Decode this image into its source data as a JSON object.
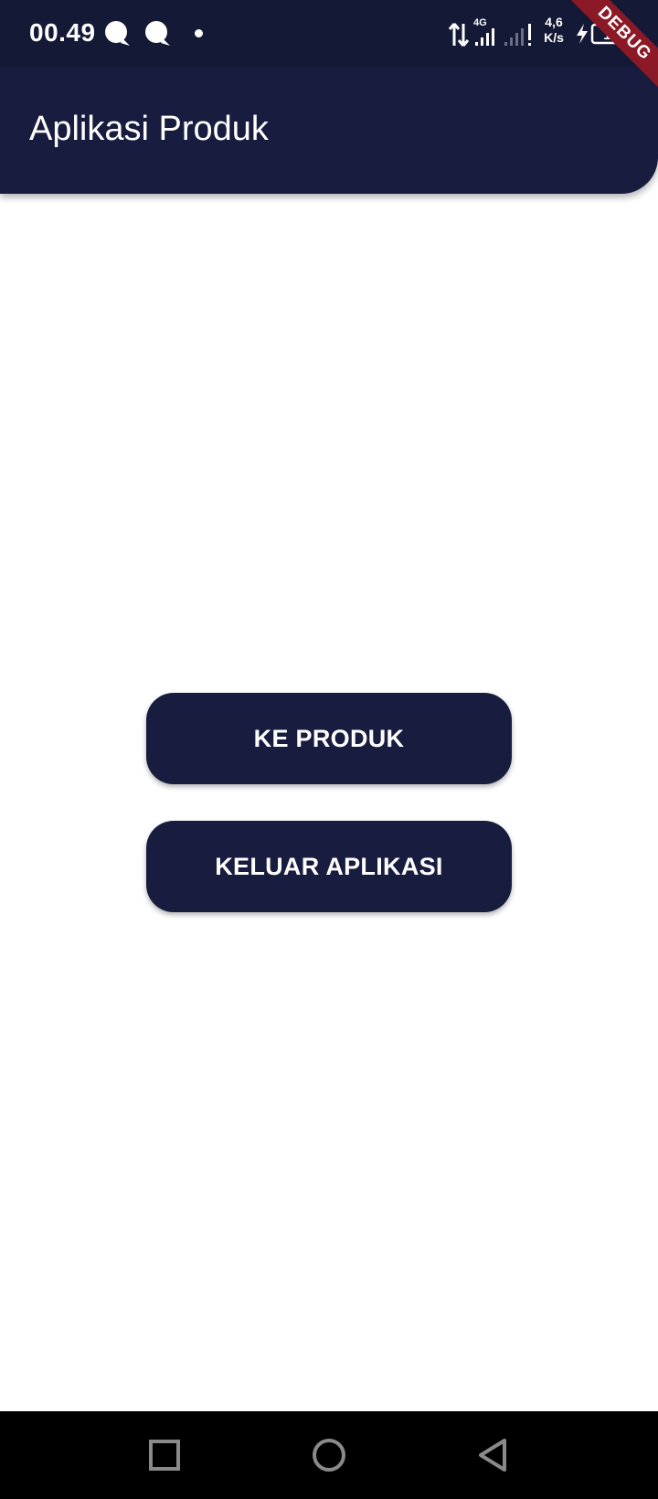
{
  "status_bar": {
    "time": "00.49",
    "network_type": "4G",
    "net_speed_value": "4,6",
    "net_speed_unit": "K/s",
    "battery_level": "19",
    "icons": [
      "chat-bubble-icon",
      "chat-bubble-icon",
      "notification-dot-icon",
      "data-transfer-icon",
      "signal-4g-icon",
      "signal-weak-icon",
      "charging-icon",
      "battery-icon"
    ]
  },
  "debug_banner": {
    "label": "DEBUG"
  },
  "app_bar": {
    "title": "Aplikasi Produk"
  },
  "buttons": {
    "to_products": "KE PRODUK",
    "exit_app": "KELUAR APLIKASI"
  },
  "nav_bar": {
    "icons": [
      "recents-square-icon",
      "home-circle-icon",
      "back-triangle-icon"
    ]
  },
  "colors": {
    "primary": "#181c3f",
    "status_bar": "#141935",
    "debug_ribbon": "#8b1a26",
    "background": "#ffffff",
    "nav_bar": "#000000"
  }
}
